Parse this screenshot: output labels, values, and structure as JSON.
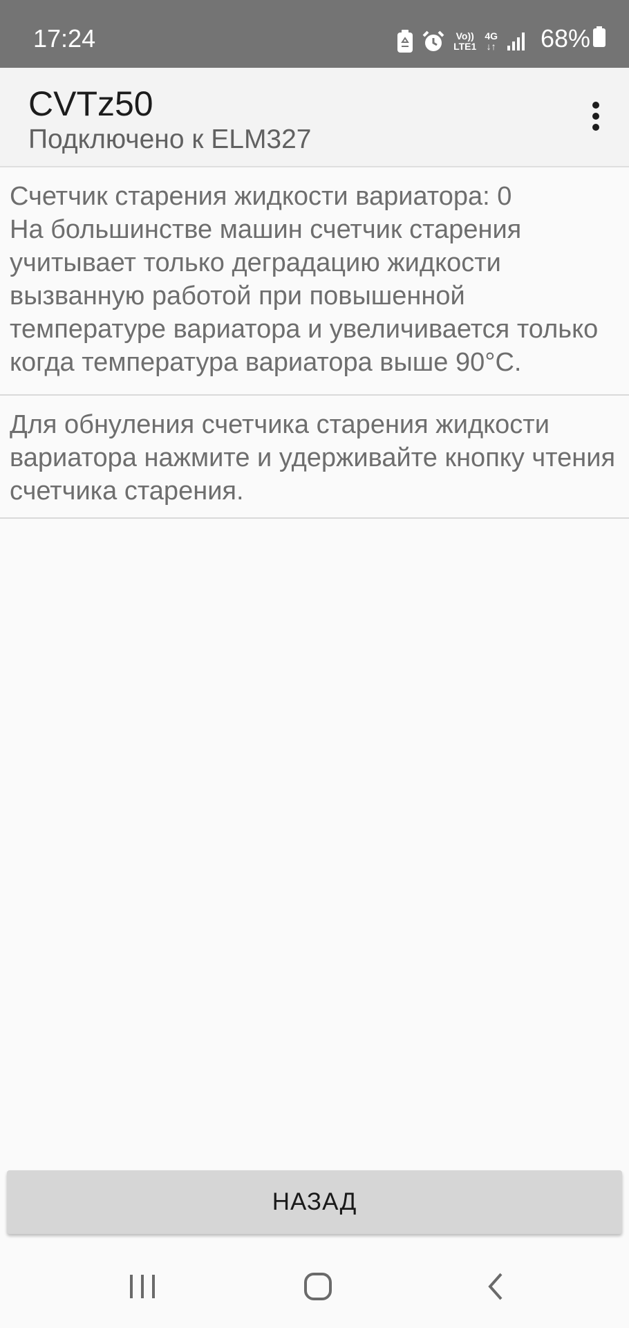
{
  "status_bar": {
    "time": "17:24",
    "battery": "68%",
    "icons": [
      "eco-mode-icon",
      "alarm-icon",
      "volte-icon",
      "network-4g-icon",
      "signal-icon",
      "battery-icon"
    ],
    "volte_top": "Vo))",
    "volte_bottom": "LTE1",
    "network_label": "4G"
  },
  "app_bar": {
    "title": "CVTz50",
    "subtitle": "Подключено к ELM327",
    "menu_icon": "more-vert-icon"
  },
  "content": {
    "aging_info": "Счетчик старения жидкости вариатора: 0\nНа большинстве машин счетчик старения учитывает только деградацию жидкости вызванную работой при повышенной температуре вариатора и увеличивается только когда температура вариатора выше 90°C.",
    "reset_info": "Для обнуления счетчика старения жидкости вариатора нажмите и удерживайте кнопку чтения счетчика старения."
  },
  "actions": {
    "back_label": "НАЗАД"
  },
  "nav_bar": {
    "icons": [
      "recent-apps-icon",
      "home-icon",
      "back-icon"
    ]
  },
  "colors": {
    "status_bar_bg": "#747474",
    "app_bar_bg": "#f3f3f3",
    "body_text": "#6e6e6e",
    "button_bg": "#d6d6d6"
  }
}
